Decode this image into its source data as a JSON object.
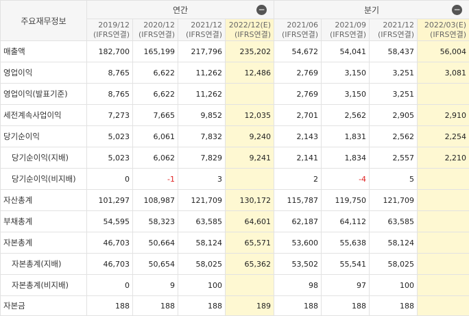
{
  "corner_label": "주요재무정보",
  "groups": {
    "annual": {
      "label": "연간",
      "collapse_icon": "minus-circle-icon",
      "collapse_glyph": "−"
    },
    "quarterly": {
      "label": "분기",
      "collapse_icon": "minus-circle-icon",
      "collapse_glyph": "−"
    }
  },
  "periods": [
    {
      "date": "2019/12",
      "basis": "(IFRS연결)",
      "estimate": false
    },
    {
      "date": "2020/12",
      "basis": "(IFRS연결)",
      "estimate": false
    },
    {
      "date": "2021/12",
      "basis": "(IFRS연결)",
      "estimate": false
    },
    {
      "date": "2022/12(E)",
      "basis": "(IFRS연결)",
      "estimate": true
    },
    {
      "date": "2021/06",
      "basis": "(IFRS연결)",
      "estimate": false
    },
    {
      "date": "2021/09",
      "basis": "(IFRS연결)",
      "estimate": false
    },
    {
      "date": "2021/12",
      "basis": "(IFRS연결)",
      "estimate": false
    },
    {
      "date": "2022/03(E)",
      "basis": "(IFRS연결)",
      "estimate": true
    }
  ],
  "rows": [
    {
      "label": "매출액",
      "sub": false,
      "values": [
        "182,700",
        "165,199",
        "217,796",
        "235,202",
        "54,672",
        "54,041",
        "58,437",
        "56,004"
      ]
    },
    {
      "label": "영업이익",
      "sub": false,
      "values": [
        "8,765",
        "6,622",
        "11,262",
        "12,486",
        "2,769",
        "3,150",
        "3,251",
        "3,081"
      ]
    },
    {
      "label": "영업이익(발표기준)",
      "sub": false,
      "values": [
        "8,765",
        "6,622",
        "11,262",
        "",
        "2,769",
        "3,150",
        "3,251",
        ""
      ]
    },
    {
      "label": "세전계속사업이익",
      "sub": false,
      "values": [
        "7,273",
        "7,665",
        "9,852",
        "12,035",
        "2,701",
        "2,562",
        "2,905",
        "2,910"
      ]
    },
    {
      "label": "당기순이익",
      "sub": false,
      "values": [
        "5,023",
        "6,061",
        "7,832",
        "9,240",
        "2,143",
        "1,831",
        "2,562",
        "2,254"
      ]
    },
    {
      "label": "당기순이익(지배)",
      "sub": true,
      "values": [
        "5,023",
        "6,062",
        "7,829",
        "9,241",
        "2,141",
        "1,834",
        "2,557",
        "2,210"
      ]
    },
    {
      "label": "당기순이익(비지배)",
      "sub": true,
      "values": [
        "0",
        "-1",
        "3",
        "",
        "2",
        "-4",
        "5",
        ""
      ]
    },
    {
      "label": "자산총계",
      "sub": false,
      "values": [
        "101,297",
        "108,987",
        "121,709",
        "130,172",
        "115,787",
        "119,750",
        "121,709",
        ""
      ]
    },
    {
      "label": "부채총계",
      "sub": false,
      "values": [
        "54,595",
        "58,323",
        "63,585",
        "64,601",
        "62,187",
        "64,112",
        "63,585",
        ""
      ]
    },
    {
      "label": "자본총계",
      "sub": false,
      "values": [
        "46,703",
        "50,664",
        "58,124",
        "65,571",
        "53,600",
        "55,638",
        "58,124",
        ""
      ]
    },
    {
      "label": "자본총계(지배)",
      "sub": true,
      "values": [
        "46,703",
        "50,654",
        "58,025",
        "65,362",
        "53,502",
        "55,541",
        "58,025",
        ""
      ]
    },
    {
      "label": "자본총계(비지배)",
      "sub": true,
      "values": [
        "0",
        "9",
        "100",
        "",
        "98",
        "97",
        "100",
        ""
      ]
    },
    {
      "label": "자본금",
      "sub": false,
      "values": [
        "188",
        "188",
        "188",
        "189",
        "188",
        "188",
        "188",
        ""
      ]
    }
  ],
  "colors": {
    "estimate_bg": "#fef8d2",
    "negative": "#e02020",
    "header_bg": "#f6f6f6",
    "border": "#e2e2e2"
  }
}
